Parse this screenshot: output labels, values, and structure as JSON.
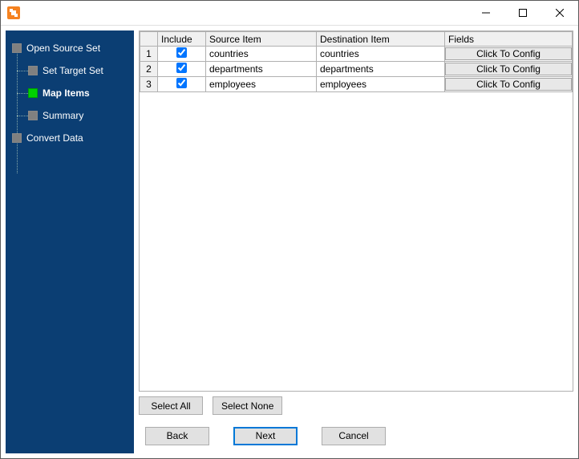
{
  "titlebar": {
    "title": ""
  },
  "sidebar": {
    "items": [
      {
        "label": "Open Source Set",
        "level": 1,
        "active": false
      },
      {
        "label": "Set Target Set",
        "level": 2,
        "active": false
      },
      {
        "label": "Map Items",
        "level": 2,
        "active": true
      },
      {
        "label": "Summary",
        "level": 2,
        "active": false
      },
      {
        "label": "Convert Data",
        "level": 1,
        "active": false
      }
    ]
  },
  "grid": {
    "headers": {
      "include": "Include",
      "source": "Source Item",
      "destination": "Destination Item",
      "fields": "Fields"
    },
    "config_label": "Click To Config",
    "rows": [
      {
        "n": "1",
        "include": true,
        "source": "countries",
        "destination": "countries"
      },
      {
        "n": "2",
        "include": true,
        "source": "departments",
        "destination": "departments"
      },
      {
        "n": "3",
        "include": true,
        "source": "employees",
        "destination": "employees"
      }
    ]
  },
  "buttons": {
    "select_all": "Select All",
    "select_none": "Select None",
    "back": "Back",
    "next": "Next",
    "cancel": "Cancel"
  }
}
